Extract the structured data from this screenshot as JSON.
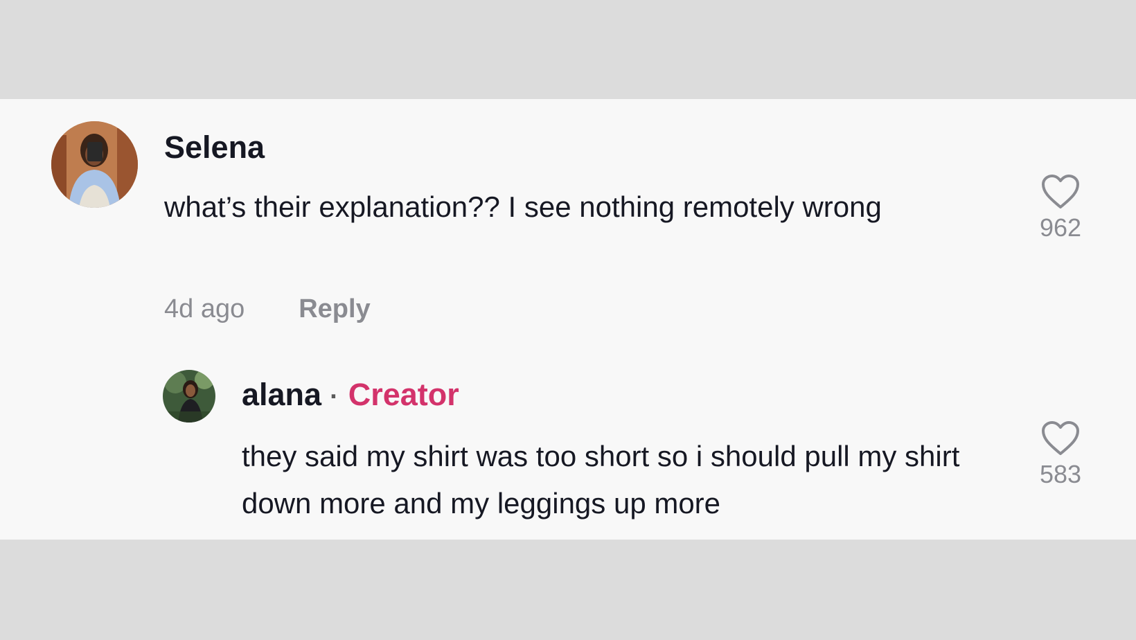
{
  "comments": [
    {
      "username": "Selena",
      "text": "what’s their explanation?? I see nothing remotely wrong",
      "timestamp": "4d ago",
      "reply_label": "Reply",
      "likes": "962",
      "avatar_icon": "avatar-photo"
    }
  ],
  "reply": {
    "username": "alana",
    "separator": "·",
    "badge": "Creator",
    "text": "they said my shirt was too short so i should pull my shirt down more and my leggings up more",
    "likes": "583",
    "avatar_icon": "avatar-photo"
  },
  "colors": {
    "page_bg": "#dcdcdc",
    "panel_bg": "#f8f8f8",
    "text": "#161823",
    "muted": "#8a8b91",
    "creator_badge": "#d3336b"
  },
  "icons": {
    "like": "heart-outline-icon"
  }
}
